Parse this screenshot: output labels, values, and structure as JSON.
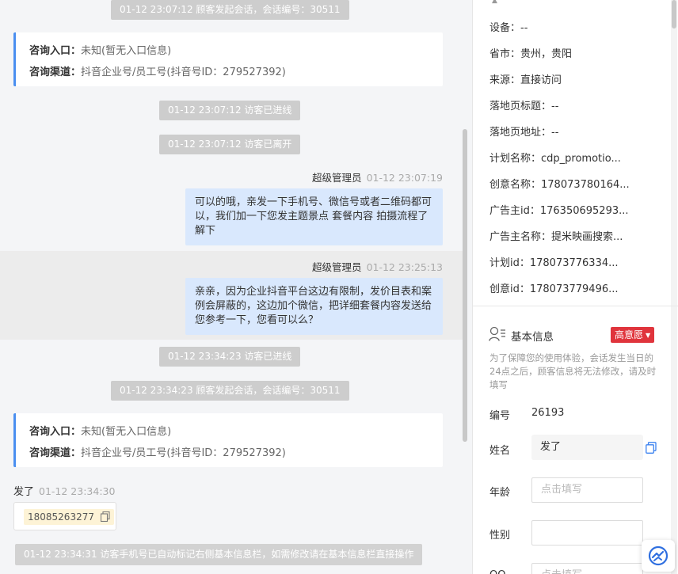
{
  "chat": {
    "sys1": "01-12 23:07:12 顾客发起会话，会话编号：30511",
    "card1": {
      "entry_label": "咨询入口：",
      "entry_value": "未知(暂无入口信息)",
      "channel_label": "咨询渠道：",
      "channel_value": "抖音企业号/员工号(抖音号ID：279527392)"
    },
    "sys2": "01-12 23:07:12 访客已进线",
    "sys3": "01-12 23:07:12 访客已离开",
    "msg1": {
      "sender": "超级管理员",
      "time": "01-12 23:07:19",
      "text": "可以的哦，亲发一下手机号、微信号或者二维码都可以，我们加一下您发主题景点 套餐内容 拍摄流程了解下"
    },
    "msg2": {
      "sender": "超级管理员",
      "time": "01-12 23:25:13",
      "text": "亲亲，因为企业抖音平台这边有限制，发价目表和案例会屏蔽的，这边加个微信，把详细套餐内容发送给您参考一下，您看可以么？"
    },
    "sys4": "01-12 23:34:23 访客已进线",
    "sys5": "01-12 23:34:23 顾客发起会话，会话编号：30511",
    "card2": {
      "entry_label": "咨询入口：",
      "entry_value": "未知(暂无入口信息)",
      "channel_label": "咨询渠道：",
      "channel_value": "抖音企业号/员工号(抖音号ID：279527392)"
    },
    "msg3": {
      "sender": "发了",
      "time": "01-12 23:34:30",
      "phone": "18085263277"
    },
    "sys6": "01-12 23:34:31 访客手机号已自动标记右侧基本信息栏，如需修改请在基本信息栏直接操作"
  },
  "info": {
    "rows": [
      "设备：--",
      "省市：贵州，贵阳",
      "来源：直接访问",
      "落地页标题：--",
      "落地页地址：--",
      "计划名称：cdp_promotio...",
      "创意名称：178073780164...",
      "广告主id：176350695293...",
      "广告主名称：提米映画搜索...",
      "计划id：178073776334...",
      "创意id：178073779496..."
    ],
    "section_title": "基本信息",
    "intent_badge": "高意愿",
    "note": "为了保障您的使用体验，会话发生当日的24点之后，顾客信息将无法修改，请及时填写",
    "id_label": "编号",
    "id_value": "26193",
    "name_label": "姓名",
    "name_value": "发了",
    "age_label": "年龄",
    "age_placeholder": "点击填写",
    "gender_label": "性别",
    "qq_label": "QQ",
    "qq_placeholder": "点击填写"
  },
  "colors": {
    "accent": "#4a8ff0",
    "bubble": "#d9e8fd",
    "badge": "#e0343c"
  }
}
